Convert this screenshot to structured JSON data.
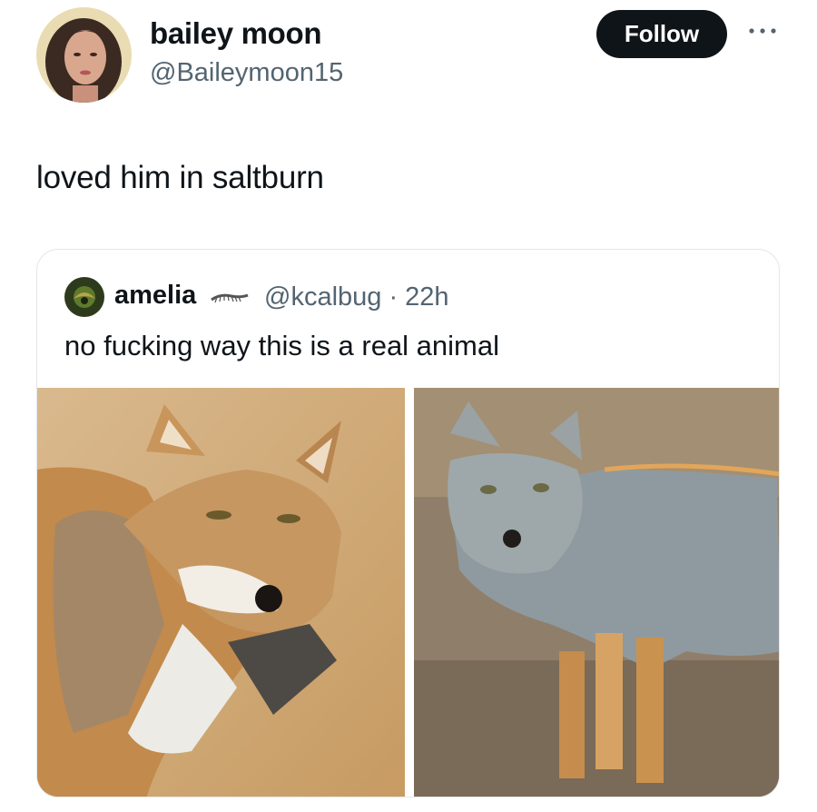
{
  "tweet": {
    "display_name": "bailey moon",
    "handle": "@Baileymoon15",
    "follow_label": "Follow",
    "text": "loved him in saltburn"
  },
  "quote": {
    "display_name": "amelia",
    "name_emoji": "centipede-emoji",
    "handle_time": "@kcalbug · 22h",
    "text": "no fucking way this is a real animal",
    "photos": [
      "tibetan-fox-photo-closeup",
      "tibetan-fox-photo-standing"
    ]
  },
  "colors": {
    "follow_bg": "#0f1419",
    "secondary_text": "#536471",
    "card_border": "#e3e7ea"
  }
}
